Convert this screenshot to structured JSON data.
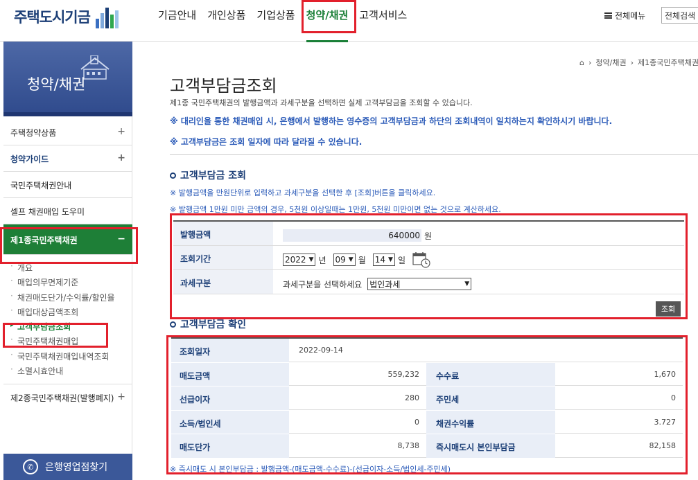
{
  "header": {
    "logo_text": "주택도시기금",
    "nav": [
      "기금안내",
      "개인상품",
      "기업상품",
      "청약/채권",
      "고객서비스"
    ],
    "active_nav": "청약/채권",
    "all_menu": "전체메뉴",
    "search_select": "전체검색"
  },
  "sidebar": {
    "title": "청약/채권",
    "items": [
      {
        "label": "주택청약상품",
        "expand": "+"
      },
      {
        "label": "청약가이드",
        "expand": "+"
      },
      {
        "label": "국민주택채권안내"
      },
      {
        "label": "셀프 채권매입 도우미"
      }
    ],
    "active_item": {
      "label": "제1종국민주택채권",
      "expand": "−"
    },
    "sub_items": [
      "개요",
      "매입의무면제기준",
      "채권매도단가/수익률/할인율",
      "매입대상금액조회",
      "고객부담금조회",
      "국민주택채권매입",
      "국민주택채권매입내역조회",
      "소멸시효안내"
    ],
    "current_sub": "고객부담금조회",
    "bottom_item": {
      "label": "제2종국민주택채권(발행폐지)",
      "expand": "+"
    },
    "bank_button": "은행영업점찾기"
  },
  "breadcrumb": [
    "청약/채권",
    "제1종국민주택채권"
  ],
  "page": {
    "title": "고객부담금조회",
    "desc": "제1종 국민주택채권의 발행금액과 과세구분을 선택하면 실제 고객부담금을 조회할 수 있습니다.",
    "notice1": "※ 대리인을 통한 채권매입 시, 은행에서 발행하는 영수증의 고객부담금과 하단의 조회내역이 일치하는지 확인하시기 바랍니다.",
    "notice2": "※ 고객부담금은 조회 일자에 따라 달라질 수 있습니다."
  },
  "inquiry": {
    "section_title": "고객부담금 조회",
    "guide1": "※ 발행금액을 만원단위로 입력하고 과세구분을 선택한 후 [조회]버튼을 클릭하세요.",
    "guide2": "※ 발행금액 1만원 미만 금액의 경우, 5천원 이상일때는 1만원, 5천원 미만이면 없는 것으로 계산하세요.",
    "amount_label": "발행금액",
    "amount_value": "640000",
    "amount_unit": "원",
    "period_label": "조회기간",
    "year": "2022",
    "year_unit": "년",
    "month": "09",
    "month_unit": "월",
    "day": "14",
    "day_unit": "일",
    "tax_label": "과세구분",
    "tax_prompt": "과세구분을 선택하세요",
    "tax_value": "법인과세",
    "search_button": "조회"
  },
  "result": {
    "section_title": "고객부담금 확인",
    "date_label": "조회일자",
    "date_value": "2022-09-14",
    "rows": [
      {
        "l1": "매도금액",
        "v1": "559,232",
        "l2": "수수료",
        "v2": "1,670"
      },
      {
        "l1": "선급이자",
        "v1": "280",
        "l2": "주민세",
        "v2": "0"
      },
      {
        "l1": "소득/법인세",
        "v1": "0",
        "l2": "채권수익률",
        "v2": "3.727"
      },
      {
        "l1": "매도단가",
        "v1": "8,738",
        "l2": "즉시매도시 본인부담금",
        "v2": "82,158"
      }
    ],
    "formula": "※ 즉시매도 시 본인부담금 : 발행금액-(매도금액-수수료)-(선급이자-소득/법인세-주민세)"
  }
}
